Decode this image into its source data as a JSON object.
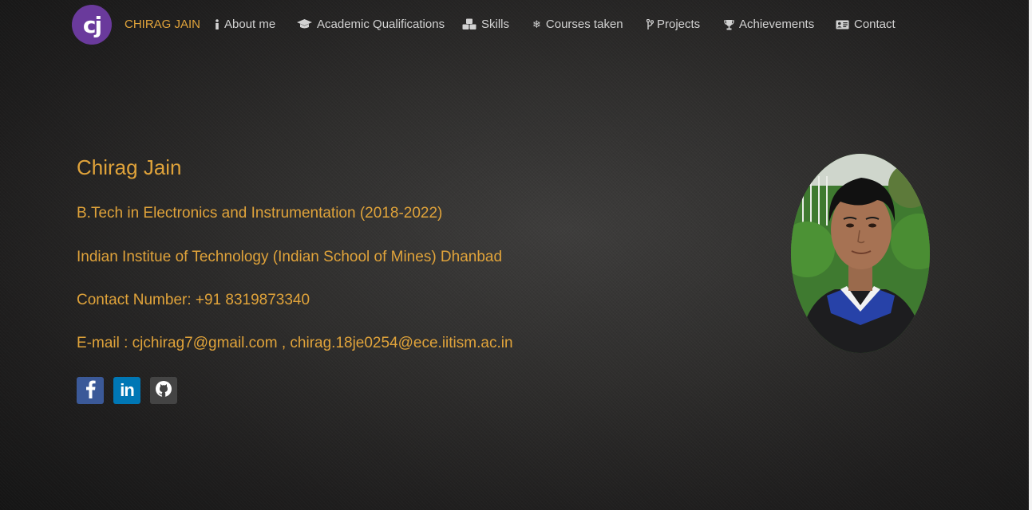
{
  "brand": {
    "logo_text": "cj",
    "name": "CHIRAG JAIN"
  },
  "nav": [
    {
      "label": "About me",
      "icon": "info-icon"
    },
    {
      "label": "Academic Qualifications",
      "icon": "graduation-cap-icon"
    },
    {
      "label": "Skills",
      "icon": "cubes-icon"
    },
    {
      "label": "Courses taken",
      "icon": "snowflake-icon"
    },
    {
      "label": "Projects",
      "icon": "branch-icon"
    },
    {
      "label": "Achievements",
      "icon": "trophy-icon"
    },
    {
      "label": "Contact",
      "icon": "id-card-icon"
    }
  ],
  "profile": {
    "name": "Chirag Jain",
    "degree": "B.Tech in Electronics and Instrumentation (2018-2022)",
    "institute": "Indian Institue of Technology (Indian School of Mines) Dhanbad",
    "contact": "Contact Number: +91 8319873340",
    "email": "E-mail : cjchirag7@gmail.com , chirag.18je0254@ece.iitism.ac.in"
  },
  "social": [
    {
      "icon": "facebook-icon",
      "color": "#3b5998"
    },
    {
      "icon": "linkedin-icon",
      "color": "#0077b5"
    },
    {
      "icon": "github-icon",
      "color": "#444444"
    }
  ],
  "colors": {
    "accent": "#e0a33a",
    "nav_text": "#d2d2d2",
    "logo_bg": "#6a3a9c"
  }
}
